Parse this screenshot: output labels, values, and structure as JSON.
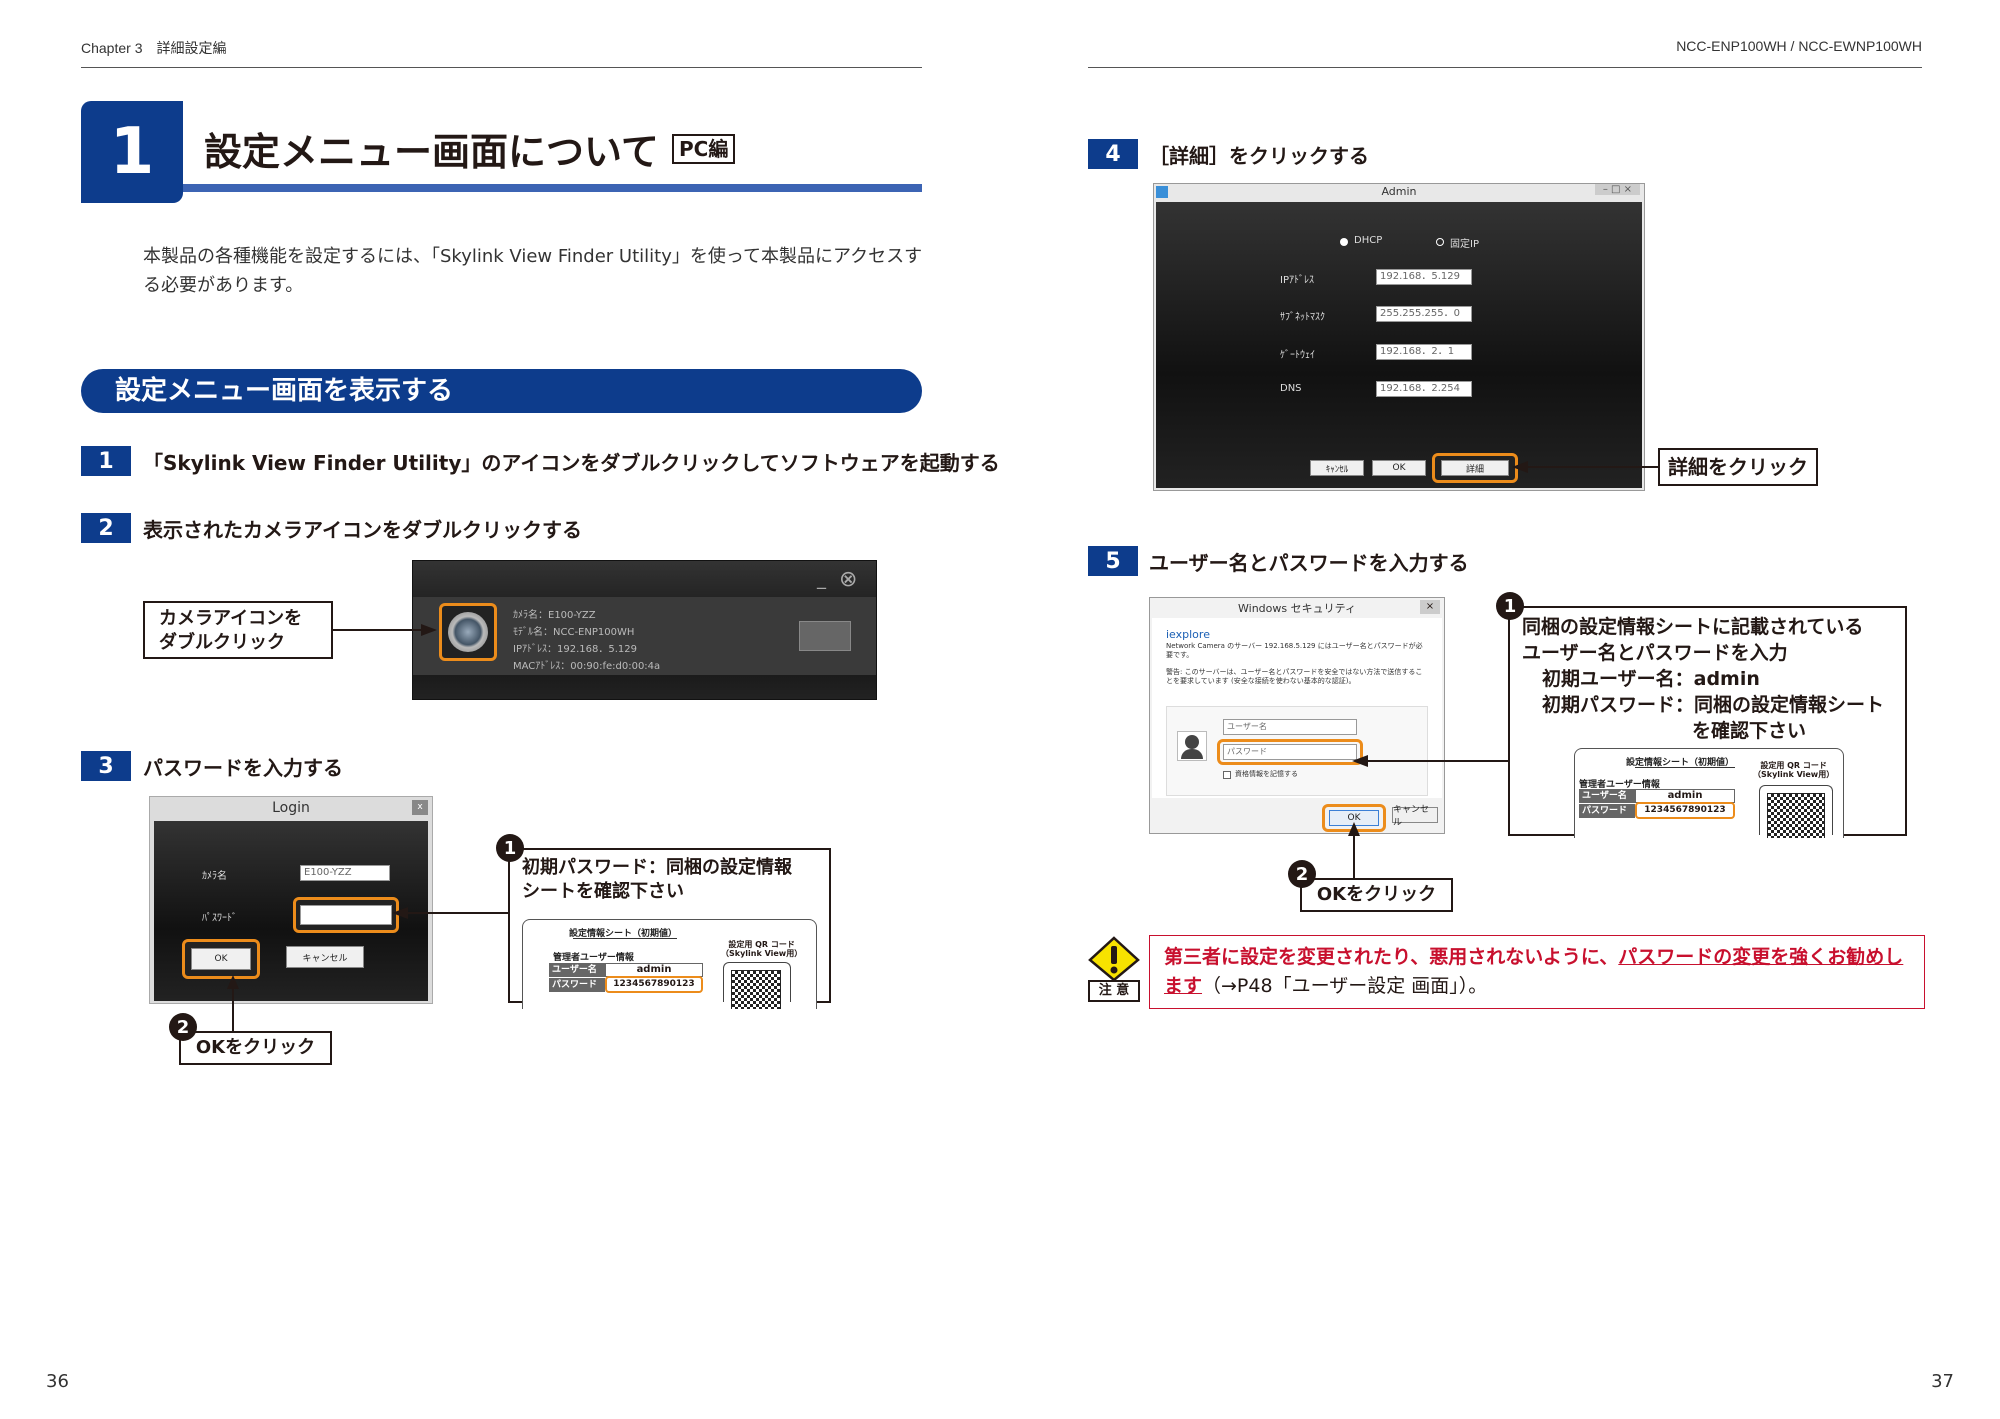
{
  "header": {
    "left": "Chapter 3　詳細設定編",
    "right": "NCC-ENP100WH / NCC-EWNP100WH"
  },
  "chapter": {
    "number": "1",
    "title": "設定メニュー画面について",
    "badge": "PC編"
  },
  "intro": "本製品の各種機能を設定するには、「Skylink View Finder Utility」を使って本製品にアクセスする必要があります。",
  "section_title": "設定メニュー画面を表示する",
  "steps": [
    {
      "num": "1",
      "text": "「Skylink View Finder Utility」のアイコンをダブルクリックしてソフトウェアを起動する"
    },
    {
      "num": "2",
      "text": "表示されたカメラアイコンをダブルクリックする"
    },
    {
      "num": "3",
      "text": "パスワードを入力する"
    },
    {
      "num": "4",
      "text": "［詳細］をクリックする"
    },
    {
      "num": "5",
      "text": "ユーザー名とパスワードを入力する"
    }
  ],
  "camera_window": {
    "callout": "カメラアイコンを\nダブルクリック",
    "lines": [
      "ｶﾒﾗ名：E100-YZZ",
      "ﾓﾃﾞﾙ名：NCC-ENP100WH",
      "IPｱﾄﾞﾚｽ：192.168．5.129",
      "MACｱﾄﾞﾚｽ：00:90:fe:d0:00:4a"
    ],
    "close_icon": "⊗",
    "min_icon": "_"
  },
  "login": {
    "title": "Login",
    "close": "x",
    "camera_label": "ｶﾒﾗ名",
    "camera_value": "E100-YZZ",
    "password_label": "ﾊﾟｽﾜｰﾄﾞ",
    "ok": "OK",
    "cancel": "キャンセル",
    "ok_callout_num": "2",
    "ok_callout": "OKをクリック",
    "pw_callout_num": "1",
    "pw_callout": "初期パスワード：同梱の設定情報\nシートを確認下さい"
  },
  "sheet": {
    "title": "設定情報シート（初期値）",
    "admin_heading": "管理者ユーザー情報",
    "qr_label": "設定用 QR コード\n（Skylink View用）",
    "user_label": "ユーザー名",
    "user_value": "admin",
    "pw_label": "パスワード",
    "pw_value": "1234567890123"
  },
  "admin_window": {
    "title": "Admin",
    "window_controls": "–  □  ×",
    "dhcp": "DHCP",
    "static": "固定IP",
    "ip_label": "IPｱﾄﾞﾚｽ",
    "ip_value": "192.168．5.129",
    "mask_label": "ｻﾌﾞﾈｯﾄﾏｽｸ",
    "mask_value": "255.255.255．0",
    "gw_label": "ｹﾞｰﾄｳｪｲ",
    "gw_value": "192.168．2．1",
    "dns_label": "DNS",
    "dns_value": "192.168．2.254",
    "cancel": "ｷｬﾝｾﾙ",
    "ok": "OK",
    "detail": "詳細",
    "callout": "詳細をクリック"
  },
  "win_security": {
    "title": "Windows セキュリティ",
    "close": "×",
    "app": "iexplore",
    "msg1": "Network Camera のサーバー 192.168.5.129 にはユーザー名とパスワードが必要です。",
    "msg2": "警告: このサーバーは、ユーザー名とパスワードを安全ではない方法で送信することを要求しています (安全な接続を使わない基本的な認証)。",
    "user_placeholder": "ユーザー名",
    "pw_placeholder": "パスワード",
    "remember": "資格情報を記憶する",
    "ok": "OK",
    "cancel": "キャンセル",
    "callout_num": "1",
    "callout_lines": [
      "同梱の設定情報シートに記載されている",
      "ユーザー名とパスワードを入力",
      "初期ユーザー名：admin",
      "初期パスワード：同梱の設定情報シート",
      "を確認下さい"
    ],
    "ok_callout_num": "2",
    "ok_callout": "OKをクリック"
  },
  "caution": {
    "icon_label": "注 意",
    "text_a": "第三者に設定を変更されたり、悪用されないように、",
    "text_b": "パスワードの変更を強くお勧めします",
    "text_c": "（→P48「ユーザー設定 画面」）。"
  },
  "page_left": "36",
  "page_right": "37",
  "colors": {
    "navy": "#0d3c8c",
    "blue_rule": "#3c64b4",
    "orange": "#ec8c1b",
    "red": "#c8102e"
  }
}
